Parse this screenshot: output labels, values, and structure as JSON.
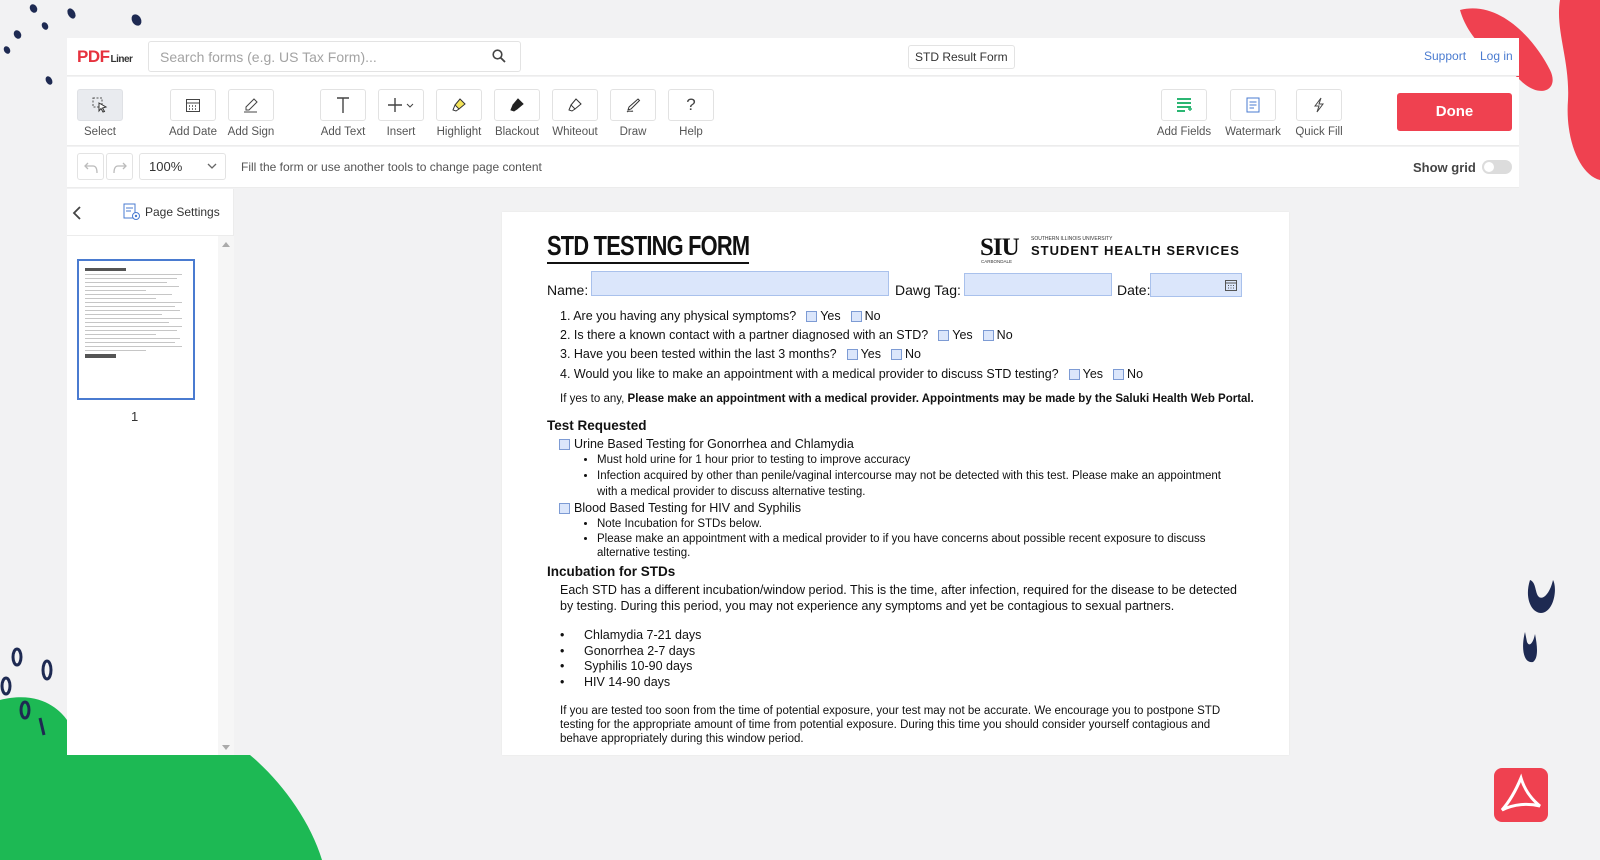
{
  "topbar": {
    "logo_main": "PDF",
    "logo_sub": "Liner",
    "search_placeholder": "Search forms (e.g. US Tax Form)...",
    "doc_name": "STD Result Form",
    "support": "Support",
    "login": "Log in"
  },
  "toolbar": {
    "tools": [
      {
        "label": "Select"
      },
      {
        "label": "Add Date"
      },
      {
        "label": "Add Sign"
      },
      {
        "label": "Add Text"
      },
      {
        "label": "Insert"
      },
      {
        "label": "Highlight"
      },
      {
        "label": "Blackout"
      },
      {
        "label": "Whiteout"
      },
      {
        "label": "Draw"
      },
      {
        "label": "Help"
      },
      {
        "label": "Add Fields"
      },
      {
        "label": "Watermark"
      },
      {
        "label": "Quick Fill"
      }
    ],
    "done": "Done"
  },
  "subbar": {
    "zoom": "100%",
    "hint": "Fill the form or use another tools to change page content",
    "show_grid": "Show grid"
  },
  "sidebar": {
    "page_settings": "Page Settings",
    "page_number": "1"
  },
  "document": {
    "title": "STD TESTING FORM",
    "logo_siu": "SIU",
    "logo_univ": "SOUTHERN ILLINOIS UNIVERSITY",
    "logo_carbondale": "CARBONDALE",
    "logo_dept": "STUDENT HEALTH SERVICES",
    "name_label": "Name:",
    "dawg_label": "Dawg Tag:",
    "date_label": "Date:",
    "yes": "Yes",
    "no": "No",
    "questions": [
      "1. Are you having any physical symptoms?",
      "2. Is there a known contact with a partner diagnosed with an STD?",
      "3. Have you been tested within the last 3 months?",
      "4. Would you like to make an appointment with a medical provider to discuss STD testing?"
    ],
    "note_prefix": "If yes to any, ",
    "note_bold": "Please make an appointment with a medical provider. Appointments may be made by  the Saluki Health Web Portal.",
    "test_heading": "Test Requested",
    "test1": "Urine Based Testing for Gonorrhea and Chlamydia",
    "test1_bullets": [
      "Must hold urine for 1 hour prior to testing to improve accuracy",
      "Infection acquired by other than penile/vaginal intercourse may not be detected with this test. Please make an appointment with a medical provider to discuss alternative testing."
    ],
    "test2": "Blood Based Testing for HIV and Syphilis",
    "test2_bullets": [
      "Note Incubation for STDs below.",
      "Please make an appointment with a medical provider to if you have concerns about possible recent exposure to discuss alternative testing."
    ],
    "incubation_heading": "Incubation for STDs",
    "incubation_text": "Each STD has a different incubation/window period. This is the time, after infection, required for the disease to be detected by testing. During this period, you may not experience any symptoms and yet be contagious to sexual partners.",
    "periods": [
      "Chlamydia 7-21 days",
      "Gonorrhea 2-7 days",
      "Syphilis 10-90 days",
      "HIV 14-90 days"
    ],
    "closing_text": "If you are tested too soon from the time of potential exposure, your test may not be accurate. We encourage you to postpone STD testing for the appropriate amount of time from potential exposure. During this time you should consider yourself contagious and behave appropriately during this window period."
  },
  "colors": {
    "brand_red": "#ef4150",
    "link_blue": "#4a7bd0",
    "field_fill": "#dbe6fb",
    "deco_green": "#1db954",
    "deco_navy": "#1e2a52"
  }
}
